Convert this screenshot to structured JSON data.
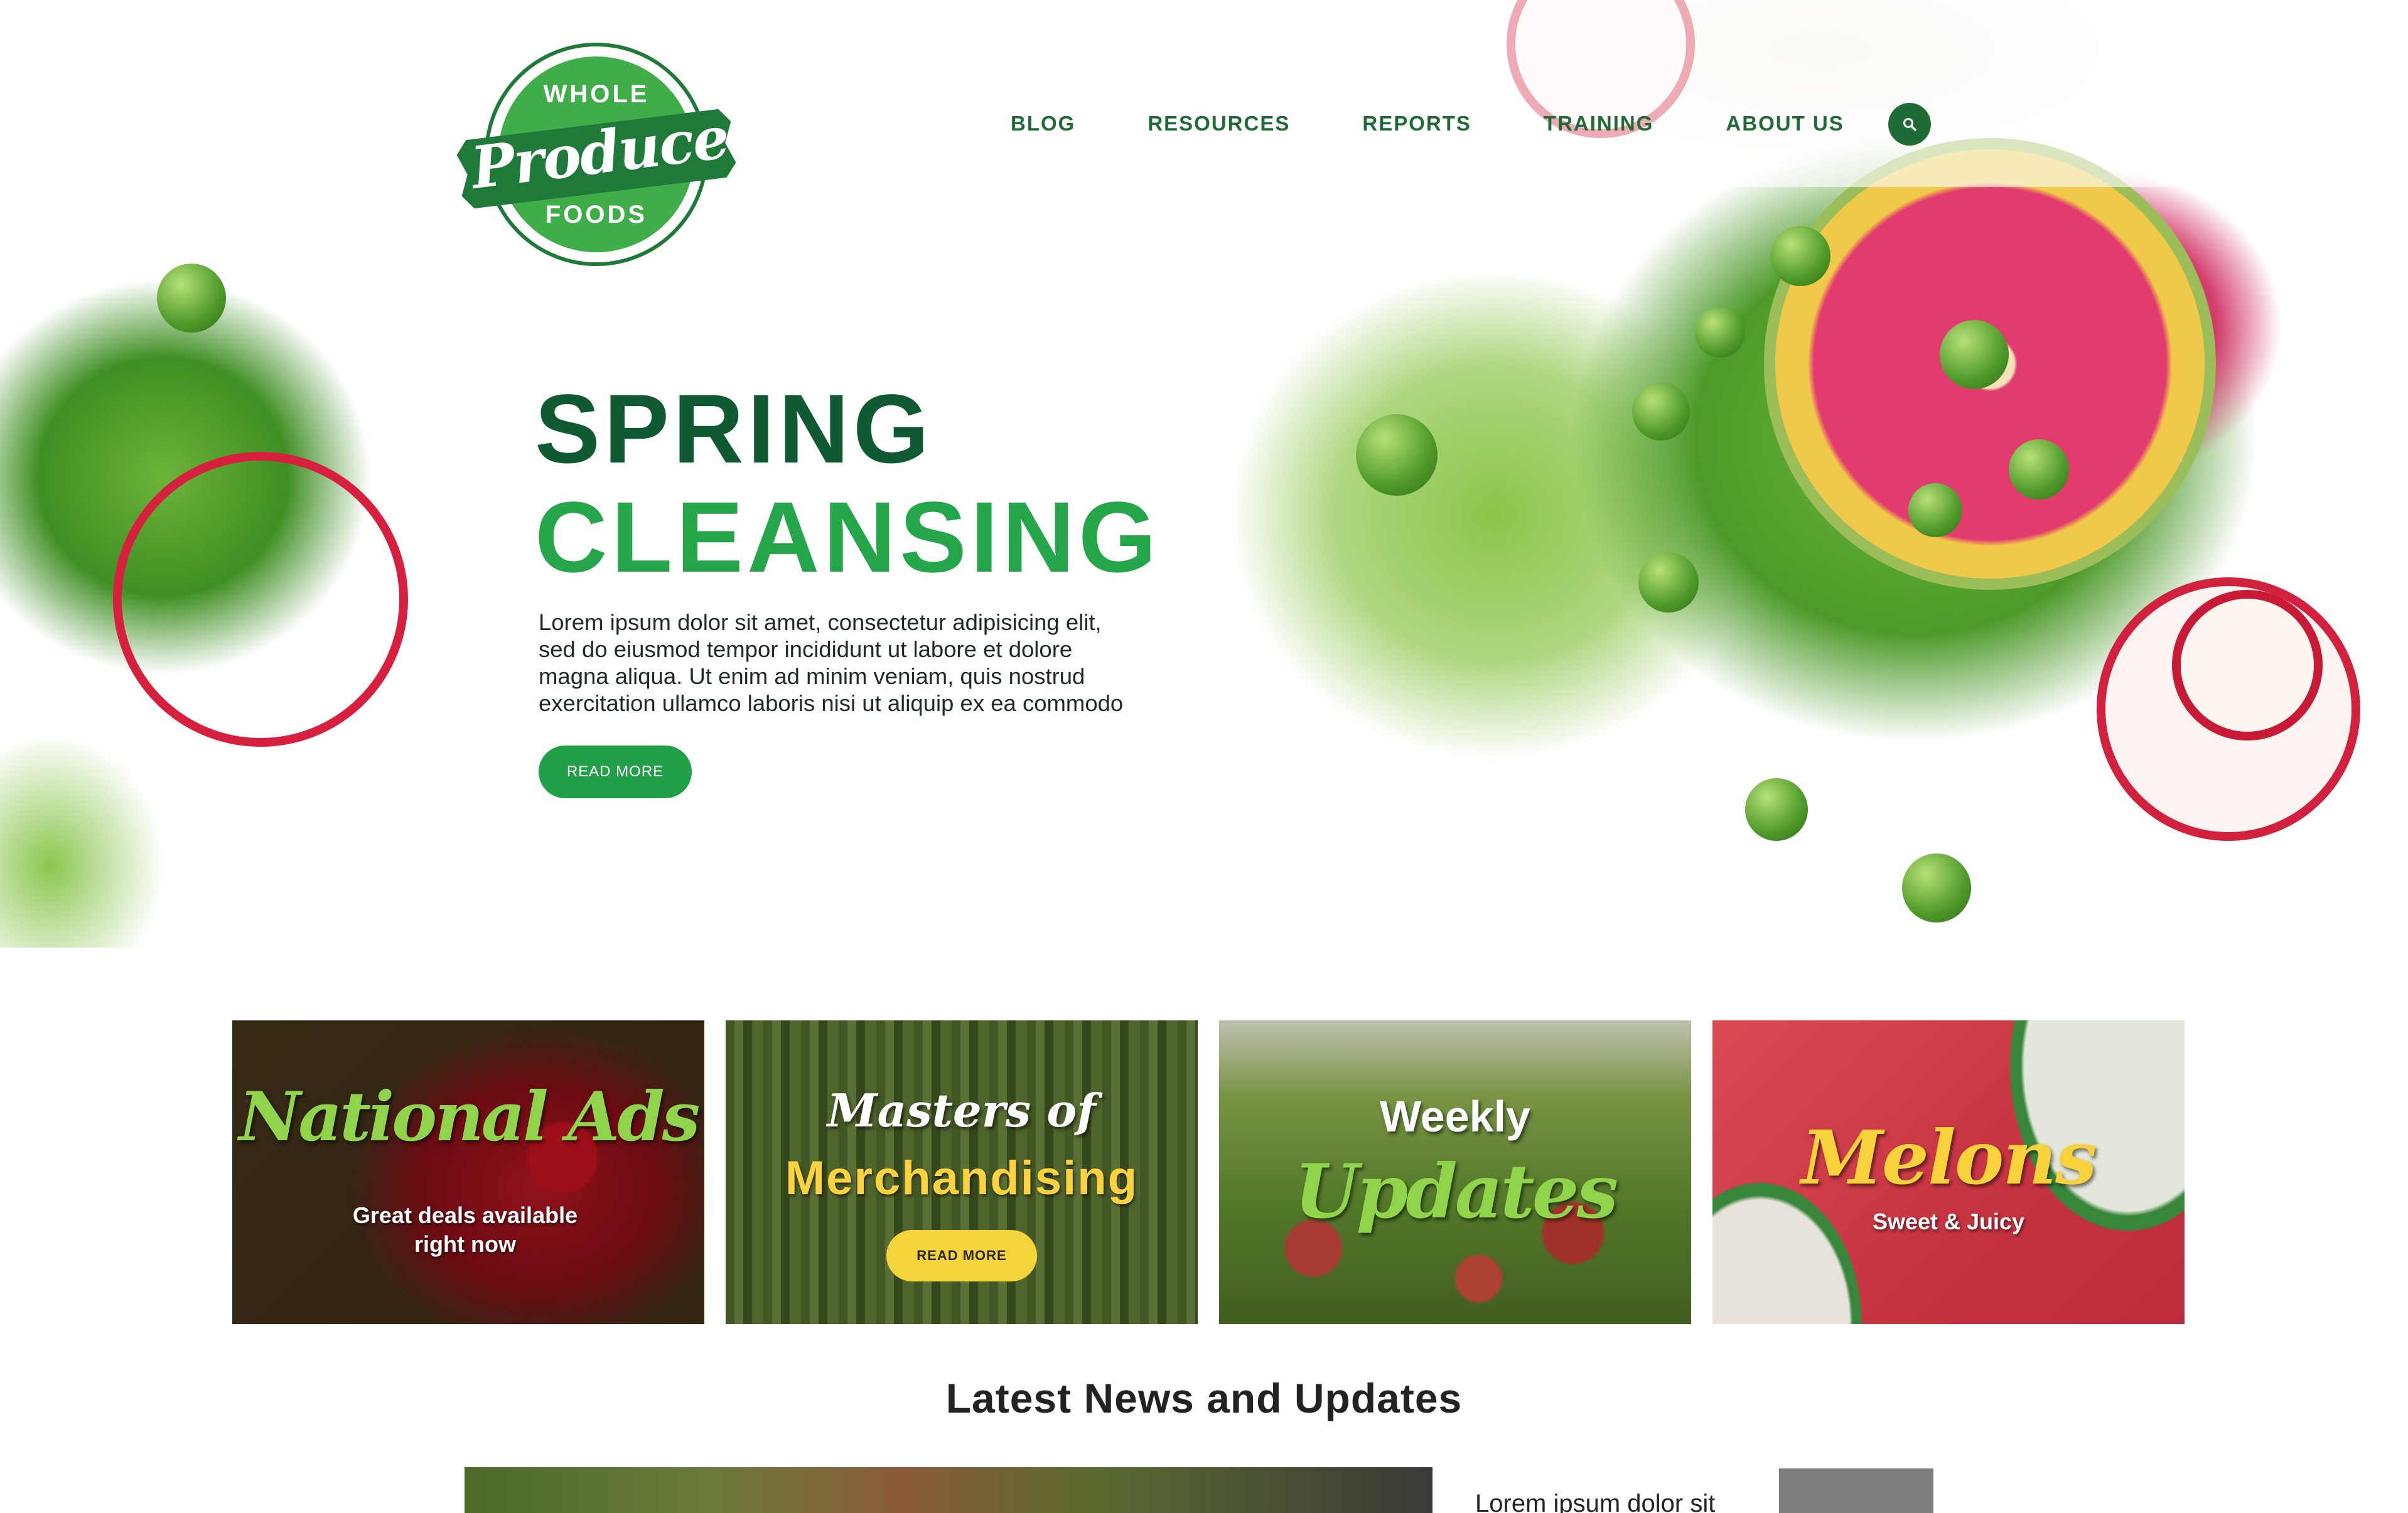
{
  "brand": {
    "logo_top": "WHOLE",
    "logo_script": "Produce",
    "logo_bottom": "FOODS",
    "primary_color": "#1f6b35",
    "accent_color": "#25a64a"
  },
  "nav": {
    "items": [
      {
        "label": "BLOG"
      },
      {
        "label": "RESOURCES"
      },
      {
        "label": "REPORTS"
      },
      {
        "label": "TRAINING"
      },
      {
        "label": "ABOUT US"
      }
    ],
    "search_icon": "search-icon"
  },
  "hero": {
    "title_line1": "SPRING",
    "title_line2": "CLEANSING",
    "body_lines": [
      "Lorem ipsum dolor sit amet, consectetur adipisicing elit,",
      "sed do eiusmod tempor incididunt ut labore et dolore",
      "magna aliqua. Ut enim ad minim veniam, quis nostrud",
      "exercitation ullamco laboris nisi ut aliquip ex ea commodo"
    ],
    "button_label": "READ MORE"
  },
  "cards": [
    {
      "title": "National Ads",
      "subtitle_line1": "Great deals available",
      "subtitle_line2": "right now"
    },
    {
      "title": "Masters of",
      "subtitle": "Merchandising",
      "button_label": "READ MORE"
    },
    {
      "title": "Weekly",
      "subtitle": "Updates"
    },
    {
      "title": "Melons",
      "subtitle": "Sweet & Juicy"
    }
  ],
  "news": {
    "heading": "Latest News and Updates",
    "first_item_title": "Lorem ipsum dolor sit"
  }
}
